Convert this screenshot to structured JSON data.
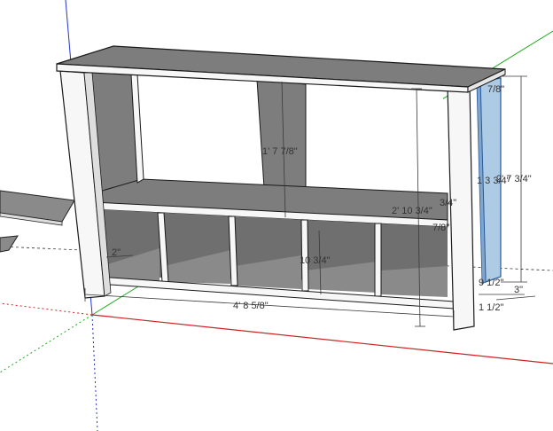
{
  "scene": {
    "colors": {
      "background": "#ffffff",
      "panel_face": "#f7f7f7",
      "panel_shade": "#7d7d7d",
      "panel_dark": "#6f6f6f",
      "selected_panel": "#aecbe6",
      "axis_red": "#cc2222",
      "axis_green": "#22aa22",
      "axis_blue": "#2233cc"
    },
    "dimensions": {
      "overall_width": "4' 8 5/8\"",
      "overall_height": "2' 10 3/4\"",
      "upper_opening": "1' 7 7/8\"",
      "lower_cubby": "10 3/4\"",
      "left_offset": "2\"",
      "shelf_thickness": "3/4\"",
      "shelf_edge": "7/8\"",
      "side_height": "2' 7 3/4\"",
      "side_label_partial": "1 3 3/4\"",
      "top_overhang": "7/8\"",
      "side_depth": "9 1/2\"",
      "base_offset": "3\"",
      "leg_width": "1 1/2\""
    }
  }
}
